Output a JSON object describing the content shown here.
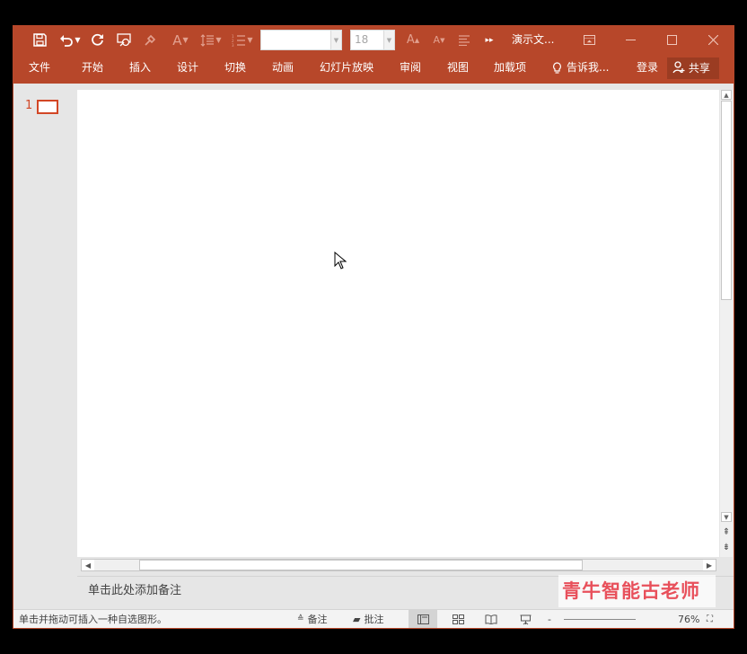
{
  "colors": {
    "accent": "#b7472a",
    "share_bg": "#9b3c22",
    "thumb_border": "#d24726",
    "watermark": "#e8505b"
  },
  "quick_access": {
    "icons": [
      "save-icon",
      "undo-icon",
      "redo-icon",
      "present-from-start-icon",
      "format-painter-icon",
      "font-color-icon",
      "line-spacing-icon",
      "numbering-icon"
    ],
    "font_name": "",
    "font_size": "18",
    "more_icon": "more-icon"
  },
  "title": "演示文...",
  "window_controls": {
    "ribbon_display_icon": "ribbon-display-options-icon",
    "minimize_icon": "minimize-icon",
    "maximize_icon": "maximize-icon",
    "close_icon": "close-icon"
  },
  "ribbon_tabs": [
    "文件",
    "开始",
    "插入",
    "设计",
    "切换",
    "动画",
    "幻灯片放映",
    "审阅",
    "视图",
    "加载项"
  ],
  "tell_me": "告诉我...",
  "signin": "登录",
  "share": "共享",
  "thumbnails": [
    {
      "number": "1"
    }
  ],
  "notes_placeholder": "单击此处添加备注",
  "status": {
    "message": "单击并拖动可插入一种自选图形。",
    "notes_label": "备注",
    "comments_label": "批注",
    "views": [
      "normal-view-icon",
      "slide-sorter-icon",
      "reading-view-icon",
      "slideshow-icon"
    ],
    "zoom": "76%"
  },
  "watermark": "青牛智能古老师"
}
